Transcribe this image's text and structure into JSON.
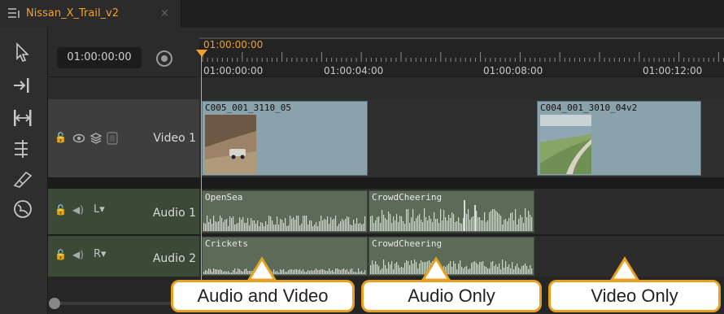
{
  "tab": {
    "title": "Nissan_X_Trail_v2",
    "close": "×"
  },
  "timecode": {
    "current": "01:00:00:00"
  },
  "ruler": {
    "playhead": "01:00:00:00",
    "ticks": [
      "01:00:00:00",
      "01:00:04:00",
      "01:00:08:00",
      "01:00:12:00"
    ]
  },
  "tracks": {
    "video1": {
      "name": "Video 1"
    },
    "audio1": {
      "name": "Audio 1",
      "channel": "L"
    },
    "audio2": {
      "name": "Audio 2",
      "channel": "R"
    }
  },
  "clips": {
    "v1": {
      "name": "C005_001_3110_05"
    },
    "v2": {
      "name": "C004_001_3010_04v2"
    },
    "a1a": {
      "name": "OpenSea"
    },
    "a1b": {
      "name": "CrowdCheering"
    },
    "a2a": {
      "name": "Crickets"
    },
    "a2b": {
      "name": "CrowdCheering"
    }
  },
  "callouts": [
    "Audio and Video",
    "Audio Only",
    "Video Only"
  ],
  "colors": {
    "accent": "#f0a030",
    "callout_border": "#e8a020",
    "video_clip": "#8aa2ab",
    "audio_clip": "#5b6b58"
  },
  "icons": [
    "menu-list-icon",
    "pointer-tool-icon",
    "track-select-icon",
    "slip-tool-icon",
    "multi-track-icon",
    "razor-icon",
    "globe-icon",
    "snap-icon",
    "lock-icon",
    "eye-icon",
    "layers-icon",
    "mute-icon"
  ]
}
